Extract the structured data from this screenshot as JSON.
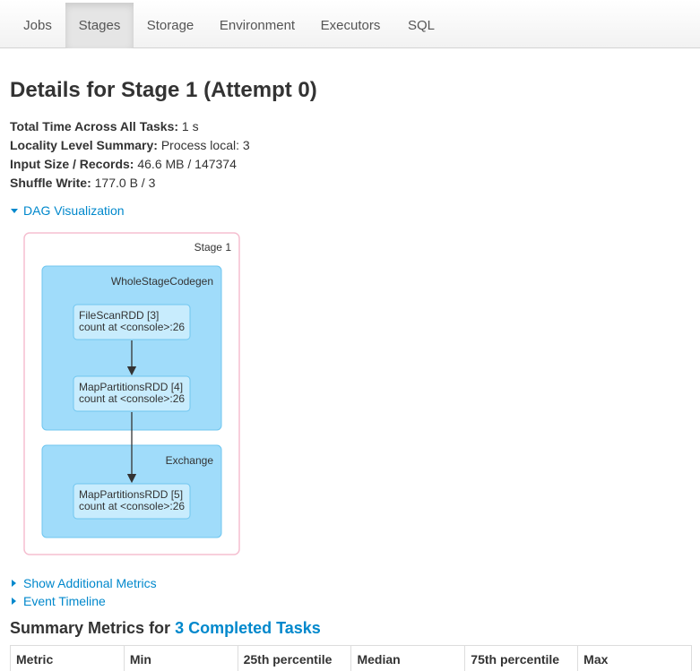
{
  "nav": {
    "tabs": [
      {
        "label": "Jobs"
      },
      {
        "label": "Stages",
        "active": true
      },
      {
        "label": "Storage"
      },
      {
        "label": "Environment"
      },
      {
        "label": "Executors"
      },
      {
        "label": "SQL"
      }
    ]
  },
  "page": {
    "title": "Details for Stage 1 (Attempt 0)"
  },
  "summary": [
    {
      "label": "Total Time Across All Tasks:",
      "value": "1 s"
    },
    {
      "label": "Locality Level Summary:",
      "value": "Process local: 3"
    },
    {
      "label": "Input Size / Records:",
      "value": "46.6 MB / 147374"
    },
    {
      "label": "Shuffle Write:",
      "value": "177.0 B / 3"
    }
  ],
  "dag_toggle": {
    "label": "DAG Visualization",
    "icon": "triangle-down-icon"
  },
  "dag": {
    "stage_label": "Stage 1",
    "clusters": [
      {
        "label": "WholeStageCodegen",
        "nodes": [
          {
            "line1": "FileScanRDD [3]",
            "line2": "count at <console>:26"
          },
          {
            "line1": "MapPartitionsRDD [4]",
            "line2": "count at <console>:26"
          }
        ]
      },
      {
        "label": "Exchange",
        "nodes": [
          {
            "line1": "MapPartitionsRDD [5]",
            "line2": "count at <console>:26"
          }
        ]
      }
    ],
    "colors": {
      "stage_border": "#f5bfd0",
      "cluster_fill": "#a0dcfa",
      "cluster_stroke": "#6fc6ef",
      "node_fill": "#c8ecfd"
    }
  },
  "additional_metrics_toggle": {
    "label": "Show Additional Metrics",
    "icon": "triangle-right-icon"
  },
  "event_timeline_toggle": {
    "label": "Event Timeline",
    "icon": "triangle-right-icon"
  },
  "summary_metrics": {
    "title_prefix": "Summary Metrics for",
    "title_link": "3 Completed Tasks",
    "columns": [
      "Metric",
      "Min",
      "25th percentile",
      "Median",
      "75th percentile",
      "Max"
    ]
  },
  "colors": {
    "link": "#0088cc",
    "text": "#333333"
  }
}
